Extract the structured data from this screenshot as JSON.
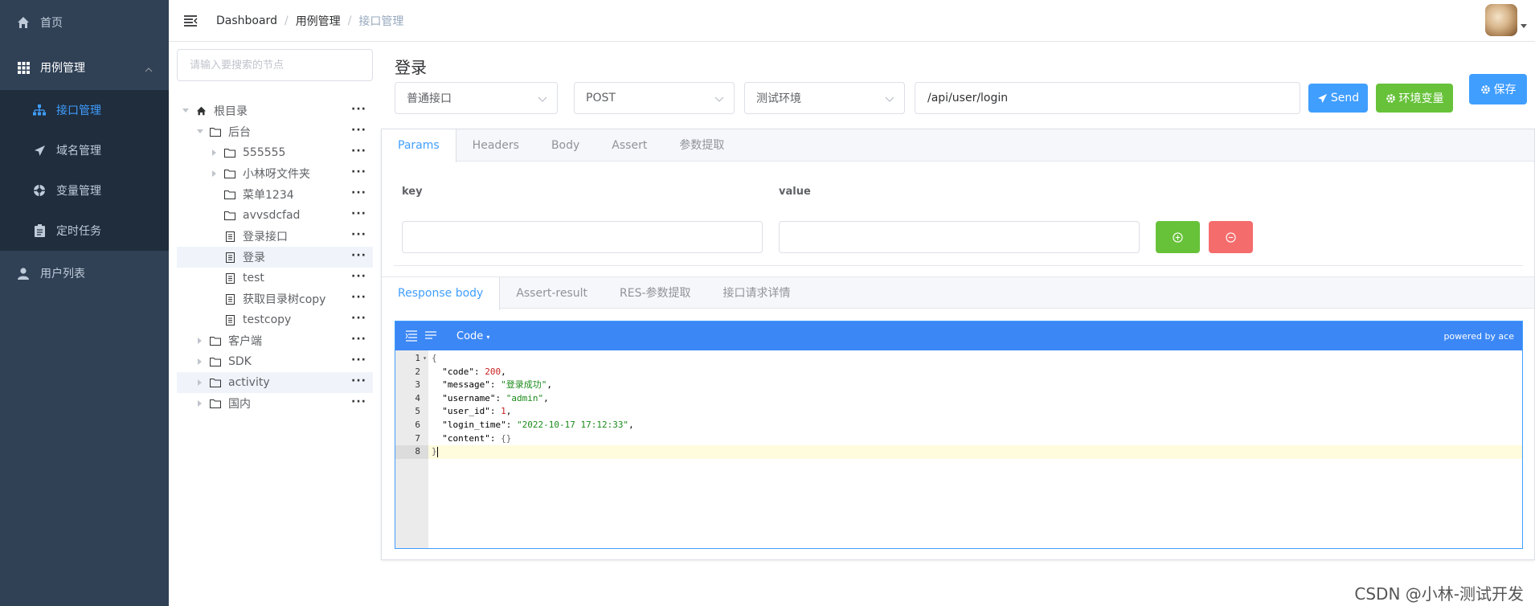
{
  "sidebar": {
    "items": [
      {
        "label": "首页",
        "icon": "home-icon"
      },
      {
        "label": "用例管理",
        "icon": "grid-icon"
      },
      {
        "label": "接口管理",
        "icon": "sitemap-icon"
      },
      {
        "label": "域名管理",
        "icon": "send-icon"
      },
      {
        "label": "变量管理",
        "icon": "life-ring-icon"
      },
      {
        "label": "定时任务",
        "icon": "clipboard-icon"
      },
      {
        "label": "用户列表",
        "icon": "user-icon"
      }
    ]
  },
  "navbar": {
    "breadcrumb": [
      "Dashboard",
      "用例管理",
      "接口管理"
    ],
    "separator": "/"
  },
  "tree": {
    "search_placeholder": "请输入要搜索的节点",
    "more": "···",
    "nodes": [
      {
        "label": "根目录",
        "type": "root"
      },
      {
        "label": "后台",
        "type": "folder"
      },
      {
        "label": "555555",
        "type": "folder"
      },
      {
        "label": "小林呀文件夹",
        "type": "folder"
      },
      {
        "label": "菜单1234",
        "type": "folder"
      },
      {
        "label": "avvsdcfad",
        "type": "folder"
      },
      {
        "label": "登录接口",
        "type": "file"
      },
      {
        "label": "登录",
        "type": "file"
      },
      {
        "label": "test",
        "type": "file"
      },
      {
        "label": "获取目录树copy",
        "type": "file"
      },
      {
        "label": "testcopy",
        "type": "file"
      },
      {
        "label": "客户端",
        "type": "folder"
      },
      {
        "label": "SDK",
        "type": "folder"
      },
      {
        "label": "activity",
        "type": "folder"
      },
      {
        "label": "国内",
        "type": "folder"
      }
    ]
  },
  "main": {
    "title": "登录",
    "type_select": "普通接口",
    "method_select": "POST",
    "env_select": "测试环境",
    "url": "/api/user/login",
    "send_label": "Send",
    "env_var_label": "环境变量",
    "save_label": "保存"
  },
  "request_tabs": [
    "Params",
    "Headers",
    "Body",
    "Assert",
    "参数提取"
  ],
  "params": {
    "key_label": "key",
    "value_label": "value"
  },
  "response_tabs": [
    "Response body",
    "Assert-result",
    "RES-参数提取",
    "接口请求详情"
  ],
  "editor": {
    "mode_label": "Code",
    "powered_by": "powered by ace",
    "line_numbers": [
      "1",
      "2",
      "3",
      "4",
      "5",
      "6",
      "7",
      "8"
    ],
    "lines": [
      {
        "open": "{"
      },
      {
        "key": "\"code\"",
        "sep": ": ",
        "num": "200",
        "end": ","
      },
      {
        "key": "\"message\"",
        "sep": ": ",
        "str": "\"登录成功\"",
        "end": ","
      },
      {
        "key": "\"username\"",
        "sep": ": ",
        "str": "\"admin\"",
        "end": ","
      },
      {
        "key": "\"user_id\"",
        "sep": ": ",
        "num": "1",
        "end": ","
      },
      {
        "key": "\"login_time\"",
        "sep": ": ",
        "str": "\"2022-10-17 17:12:33\"",
        "end": ","
      },
      {
        "key": "\"content\"",
        "sep": ": ",
        "obj": "{}"
      },
      {
        "close": "}"
      }
    ]
  },
  "watermark": "CSDN @小林-测试开发",
  "colors": {
    "sidebar_bg": "#304156",
    "submenu_bg": "#1f2d3d",
    "active": "#409eff",
    "send_btn": "#409eff",
    "env_btn": "#67c23a",
    "save_btn": "#409eff",
    "add_btn": "#67c23a",
    "remove_btn": "#f56c6c",
    "editor_toolbar": "#3b87f5"
  }
}
